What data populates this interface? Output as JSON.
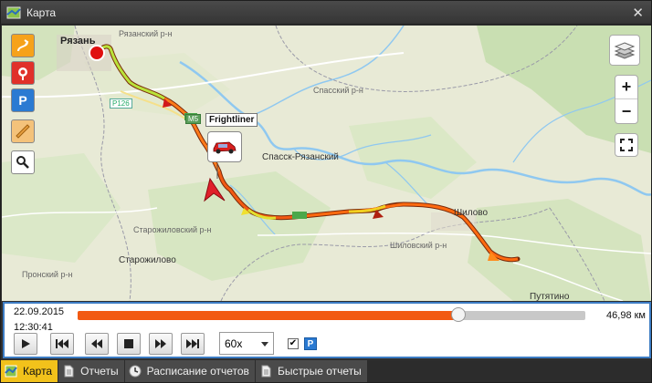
{
  "window": {
    "title": "Карта"
  },
  "map": {
    "labels": {
      "ryazan": "Рязань",
      "ryazan_area": "Рязанский р-н",
      "spassky_area": "Спасский р-н",
      "spassk": "Спасск-Рязанский",
      "shilovo": "Шилово",
      "shilovsky_area": "Шиловский р-н",
      "starozhilovsky_area": "Старожиловский р-н",
      "starozhilovo": "Старожилово",
      "pronsky_area": "Пронский р-н",
      "putyatino": "Путятино",
      "road_p126": "Р126",
      "road_m5": "М5"
    },
    "vehicle_name": "Frightliner"
  },
  "player": {
    "date": "22.09.2015",
    "time": "12:30:41",
    "progress": 0.75,
    "distance": "46,98 км",
    "speed": "60x",
    "parking_checked": true,
    "parking_label": "P"
  },
  "tabs": [
    {
      "label": "Карта",
      "icon": "map-icon"
    },
    {
      "label": "Отчеты",
      "icon": "document-icon"
    },
    {
      "label": "Расписание отчетов",
      "icon": "clock-icon"
    },
    {
      "label": "Быстрые отчеты",
      "icon": "document-icon"
    }
  ],
  "colors": {
    "accent": "#f25a13",
    "tab_active": "#f2c21b",
    "player_border": "#3c7cc4"
  }
}
